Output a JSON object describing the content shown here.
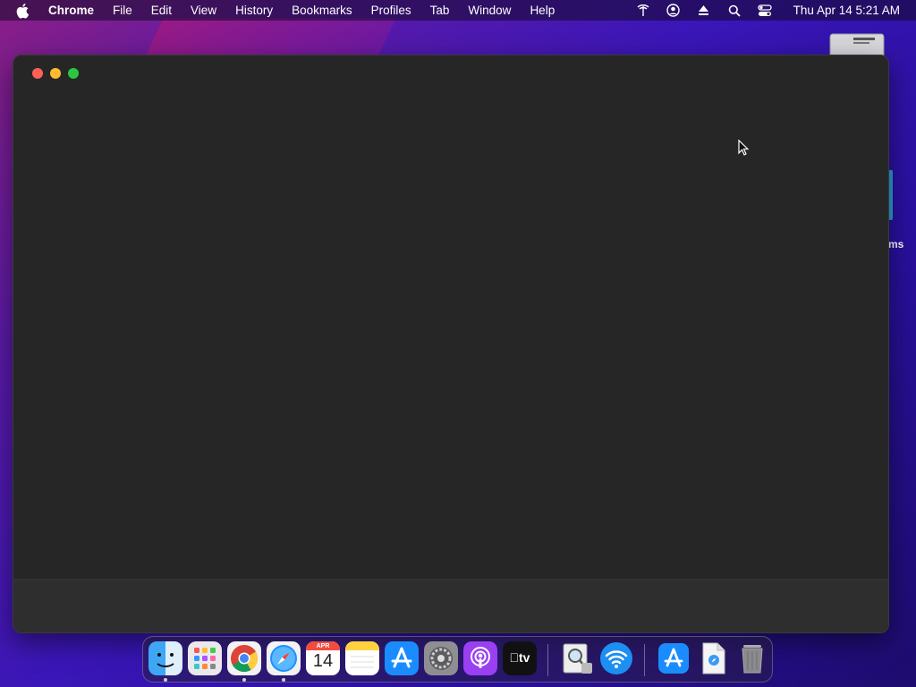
{
  "menubar": {
    "app_name": "Chrome",
    "items": [
      "File",
      "Edit",
      "View",
      "History",
      "Bookmarks",
      "Profiles",
      "Tab",
      "Window",
      "Help"
    ],
    "clock": "Thu Apr 14  5:21 AM"
  },
  "desktop": {
    "partial_label": "ms"
  },
  "dock": {
    "calendar_month": "APR",
    "calendar_day": "14",
    "tv_label": "tv"
  }
}
